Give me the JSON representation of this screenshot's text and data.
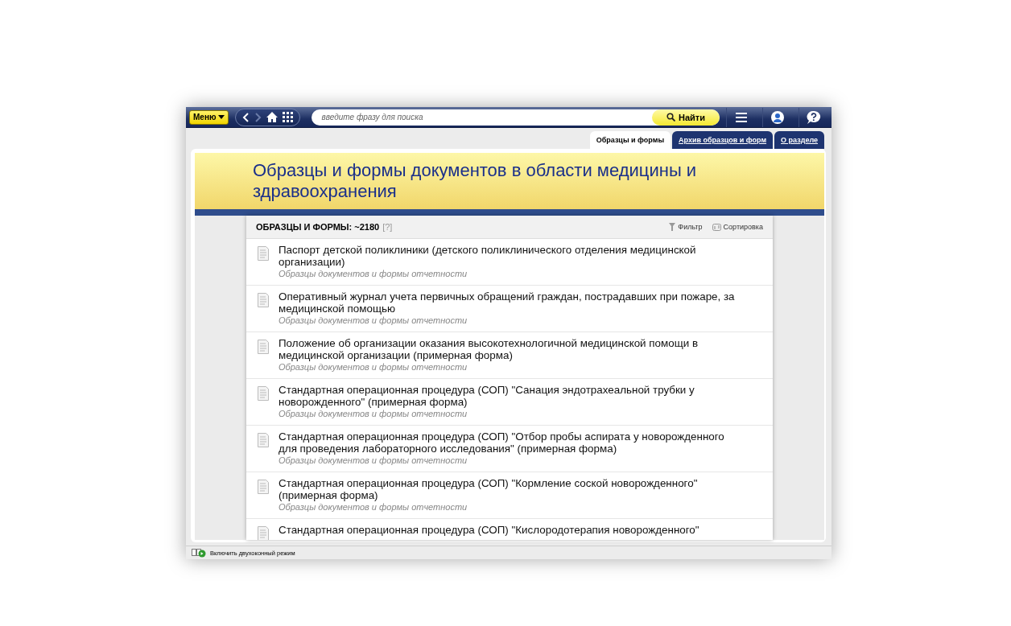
{
  "toolbar": {
    "menu_button": "Меню",
    "search": {
      "placeholder": "введите фразу для поиска"
    },
    "search_button": "Найти"
  },
  "tabs": [
    {
      "label": "Образцы и формы",
      "selected": true
    },
    {
      "label": "Архив образцов и форм",
      "selected": false
    },
    {
      "label": "О разделе",
      "selected": false
    }
  ],
  "banner": {
    "title": "Образцы и формы документов в области медицины и здравоохранения"
  },
  "list": {
    "heading": "ОБРАЗЦЫ И ФОРМЫ: ~2180",
    "help": "[?]",
    "filter": "Фильтр",
    "sort": "Сортировка",
    "items": [
      {
        "title": "Паспорт детской поликлиники (детского поликлинического отделения медицинской организации)",
        "category": "Образцы документов и формы отчетности"
      },
      {
        "title": "Оперативный журнал учета первичных обращений граждан, пострадавших при пожаре, за медицинской помощью",
        "category": "Образцы документов и формы отчетности"
      },
      {
        "title": "Положение об организации оказания высокотехнологичной медицинской помощи в медицинской организации (примерная форма)",
        "category": "Образцы документов и формы отчетности"
      },
      {
        "title": "Стандартная операционная процедура (СОП) \"Санация эндотрахеальной трубки у новорожденного\" (примерная форма)",
        "category": "Образцы документов и формы отчетности"
      },
      {
        "title": "Стандартная операционная процедура (СОП) \"Отбор пробы аспирата у новорожденного для проведения лабораторного исследования\" (примерная форма)",
        "category": "Образцы документов и формы отчетности"
      },
      {
        "title": "Стандартная операционная процедура (СОП) \"Кормление соской новорожденного\" (примерная форма)",
        "category": "Образцы документов и формы отчетности"
      },
      {
        "title": "Стандартная операционная процедура (СОП) \"Кислородотерапия новорожденного\""
      }
    ]
  },
  "status_bar": {
    "text": "Включить двухоконный режим"
  }
}
